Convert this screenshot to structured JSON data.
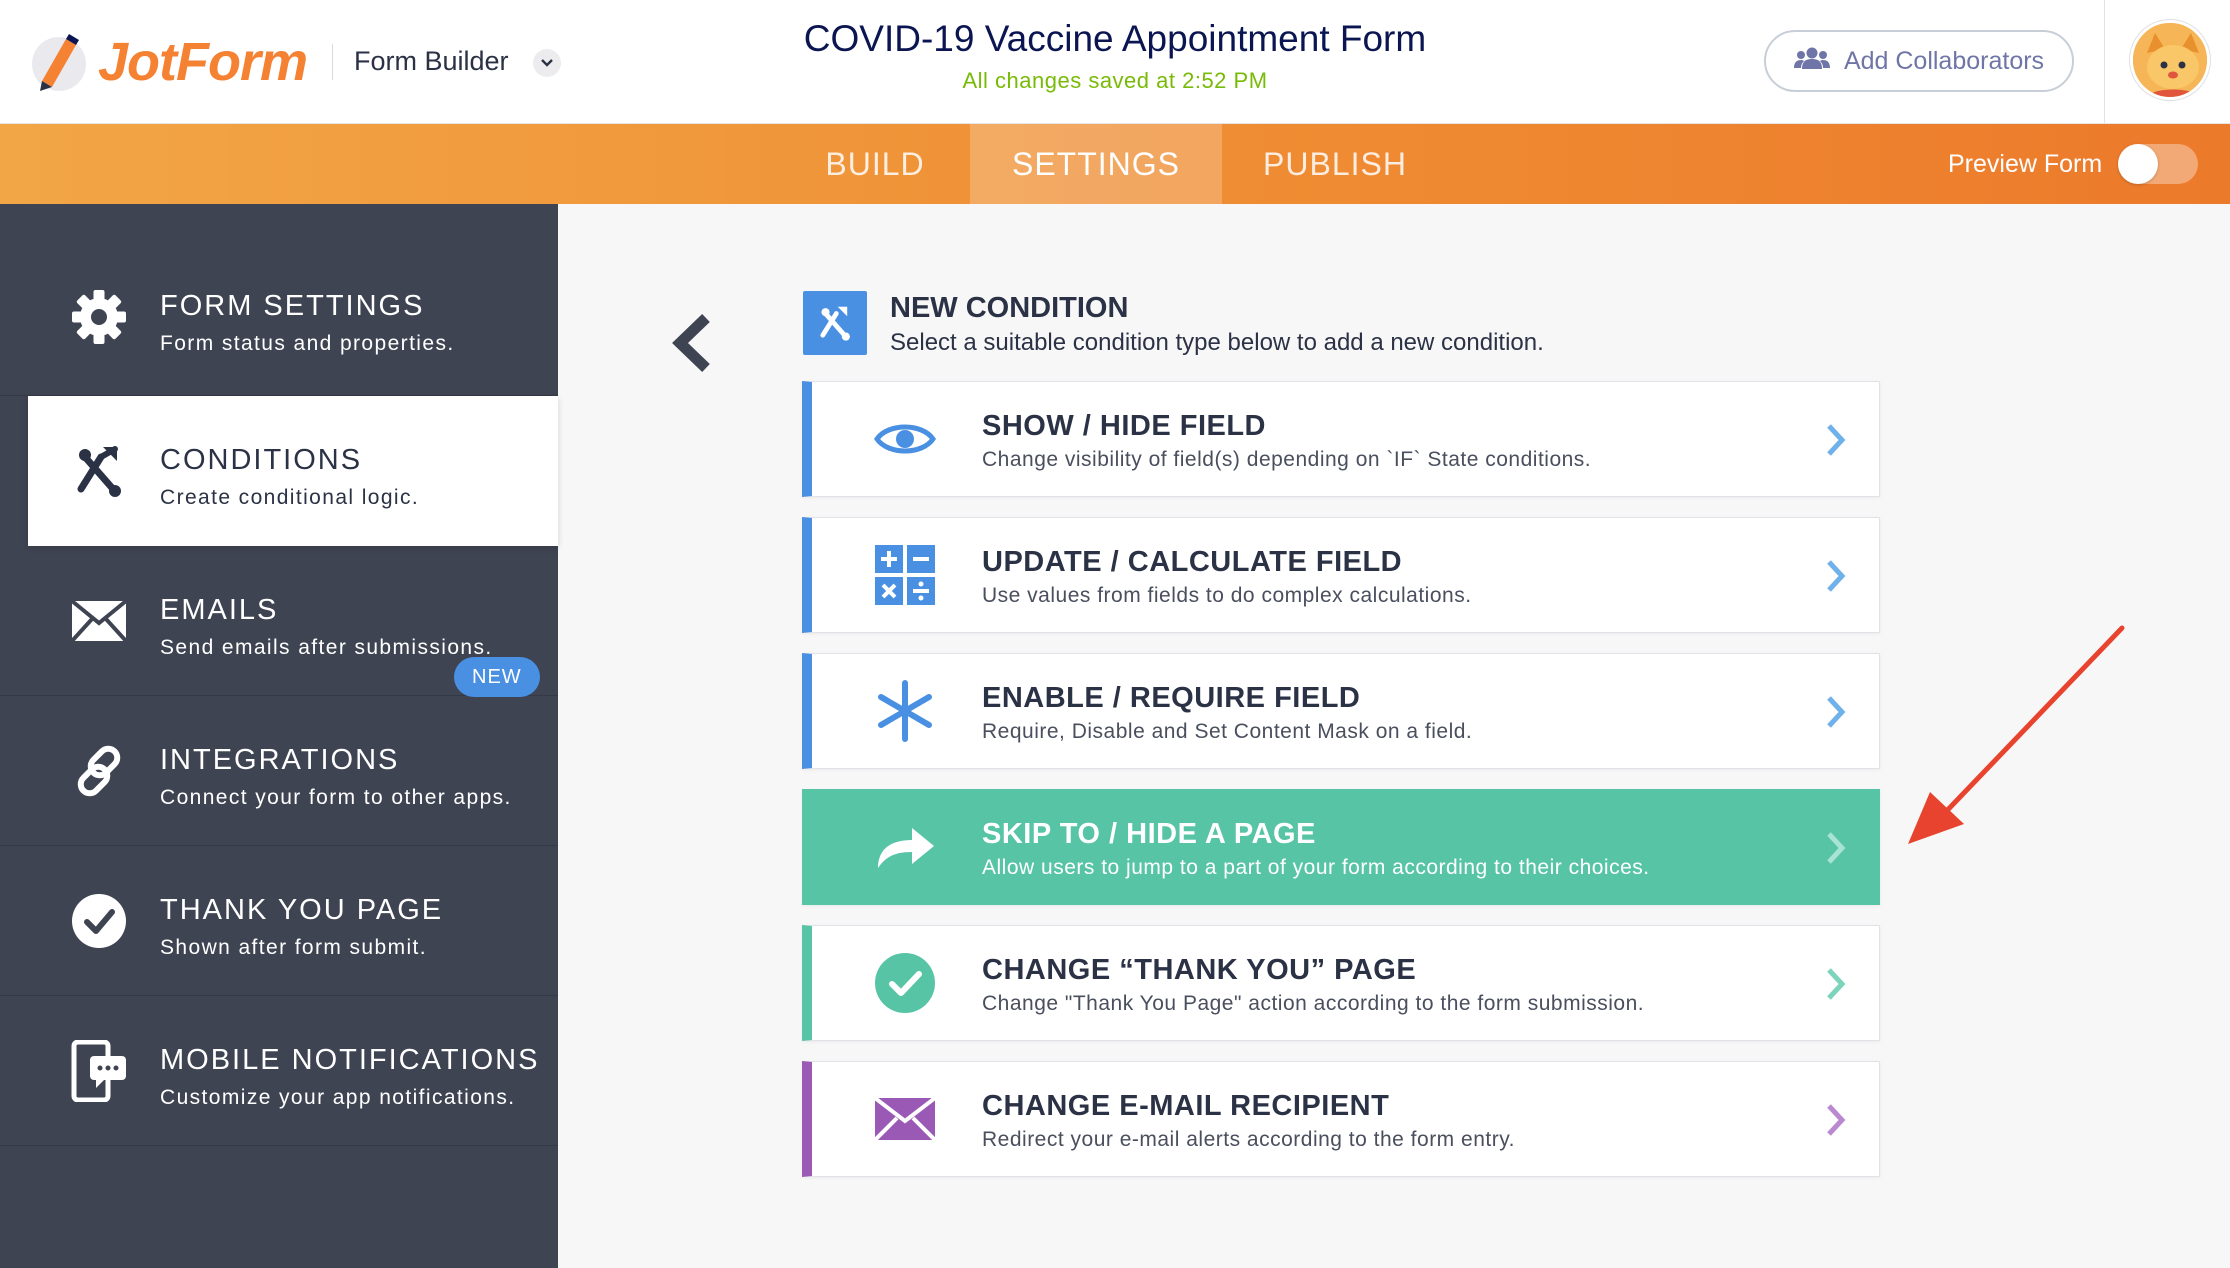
{
  "header": {
    "logo_text": "JotForm",
    "builder_label": "Form Builder",
    "form_title": "COVID-19 Vaccine Appointment Form",
    "save_status": "All changes saved at 2:52 PM",
    "collaborators_label": "Add Collaborators"
  },
  "nav": {
    "tabs": [
      {
        "label": "BUILD"
      },
      {
        "label": "SETTINGS"
      },
      {
        "label": "PUBLISH"
      }
    ],
    "active_tab": "SETTINGS",
    "preview_label": "Preview Form",
    "preview_enabled": false
  },
  "sidebar": {
    "items": [
      {
        "title": "FORM SETTINGS",
        "desc": "Form status and properties.",
        "icon": "gear-icon"
      },
      {
        "title": "CONDITIONS",
        "desc": "Create conditional logic.",
        "icon": "conditions-icon"
      },
      {
        "title": "EMAILS",
        "desc": "Send emails after submissions.",
        "icon": "envelope-icon"
      },
      {
        "title": "INTEGRATIONS",
        "desc": "Connect your form to other apps.",
        "icon": "link-icon"
      },
      {
        "title": "THANK YOU PAGE",
        "desc": "Shown after form submit.",
        "icon": "check-circle-icon",
        "badge": "NEW"
      },
      {
        "title": "MOBILE NOTIFICATIONS",
        "desc": "Customize your app notifications.",
        "icon": "mobile-chat-icon"
      }
    ],
    "active": "CONDITIONS"
  },
  "main": {
    "new_condition": {
      "title": "NEW CONDITION",
      "desc": "Select a suitable condition type below to add a new condition."
    },
    "conditions": [
      {
        "title": "SHOW / HIDE FIELD",
        "desc": "Change visibility of field(s) depending on `IF` State conditions.",
        "icon": "eye-icon",
        "color": "#4a90e2"
      },
      {
        "title": "UPDATE / CALCULATE FIELD",
        "desc": "Use values from fields to do complex calculations.",
        "icon": "calculator-icon",
        "color": "#4a90e2"
      },
      {
        "title": "ENABLE / REQUIRE FIELD",
        "desc": "Require, Disable and Set Content Mask on a field.",
        "icon": "asterisk-icon",
        "color": "#4a90e2"
      },
      {
        "title": "SKIP TO / HIDE A PAGE",
        "desc": "Allow users to jump to a part of your form according to their choices.",
        "icon": "share-arrow-icon",
        "color": "#57c4a6",
        "highlighted": true
      },
      {
        "title": "CHANGE “THANK YOU” PAGE",
        "desc": "Change \"Thank You Page\" action according to the form submission.",
        "icon": "check-circle-icon",
        "color": "#57c4a6"
      },
      {
        "title": "CHANGE E-MAIL RECIPIENT",
        "desc": "Redirect your e-mail alerts according to the form entry.",
        "icon": "envelope-icon",
        "color": "#9b59b6"
      }
    ]
  },
  "annotation": {
    "color": "#e8432e"
  }
}
